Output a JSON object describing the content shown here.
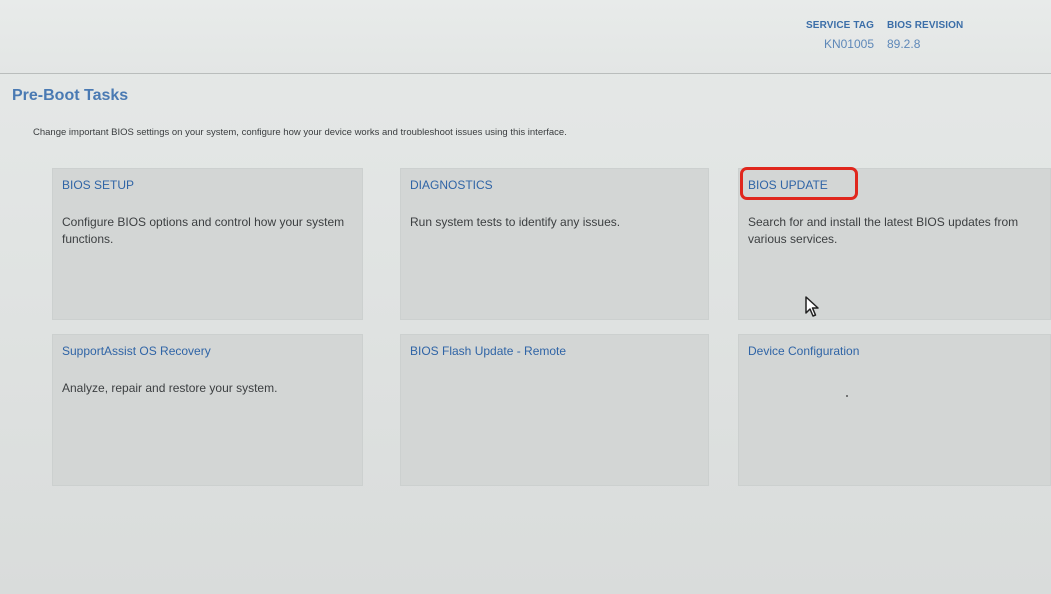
{
  "header": {
    "service_tag_label": "SERVICE TAG",
    "service_tag_value": "KN01005",
    "bios_revision_label": "BIOS REVISION",
    "bios_revision_value": "89.2.8"
  },
  "page": {
    "title": "Pre-Boot Tasks",
    "subtitle": "Change important BIOS settings on your system, configure how your device works and troubleshoot issues using this interface."
  },
  "tiles": [
    {
      "title": "BIOS SETUP",
      "description": "Configure BIOS options and control how your system functions."
    },
    {
      "title": "DIAGNOSTICS",
      "description": "Run system tests to identify any issues."
    },
    {
      "title": "BIOS UPDATE",
      "description": "Search for and install the latest BIOS updates from various services."
    },
    {
      "title": "SupportAssist OS Recovery",
      "description": "Analyze, repair and restore your system."
    },
    {
      "title": "BIOS Flash Update - Remote",
      "description": ""
    },
    {
      "title": "Device Configuration",
      "description": ""
    }
  ],
  "overlay": {
    "highlight_color": "#e0271d",
    "cursor_icon": "mouse-pointer-icon"
  },
  "colors": {
    "accent": "#2f64a6",
    "title": "#4a7ab3",
    "tile_background": "#d3d6d5"
  }
}
